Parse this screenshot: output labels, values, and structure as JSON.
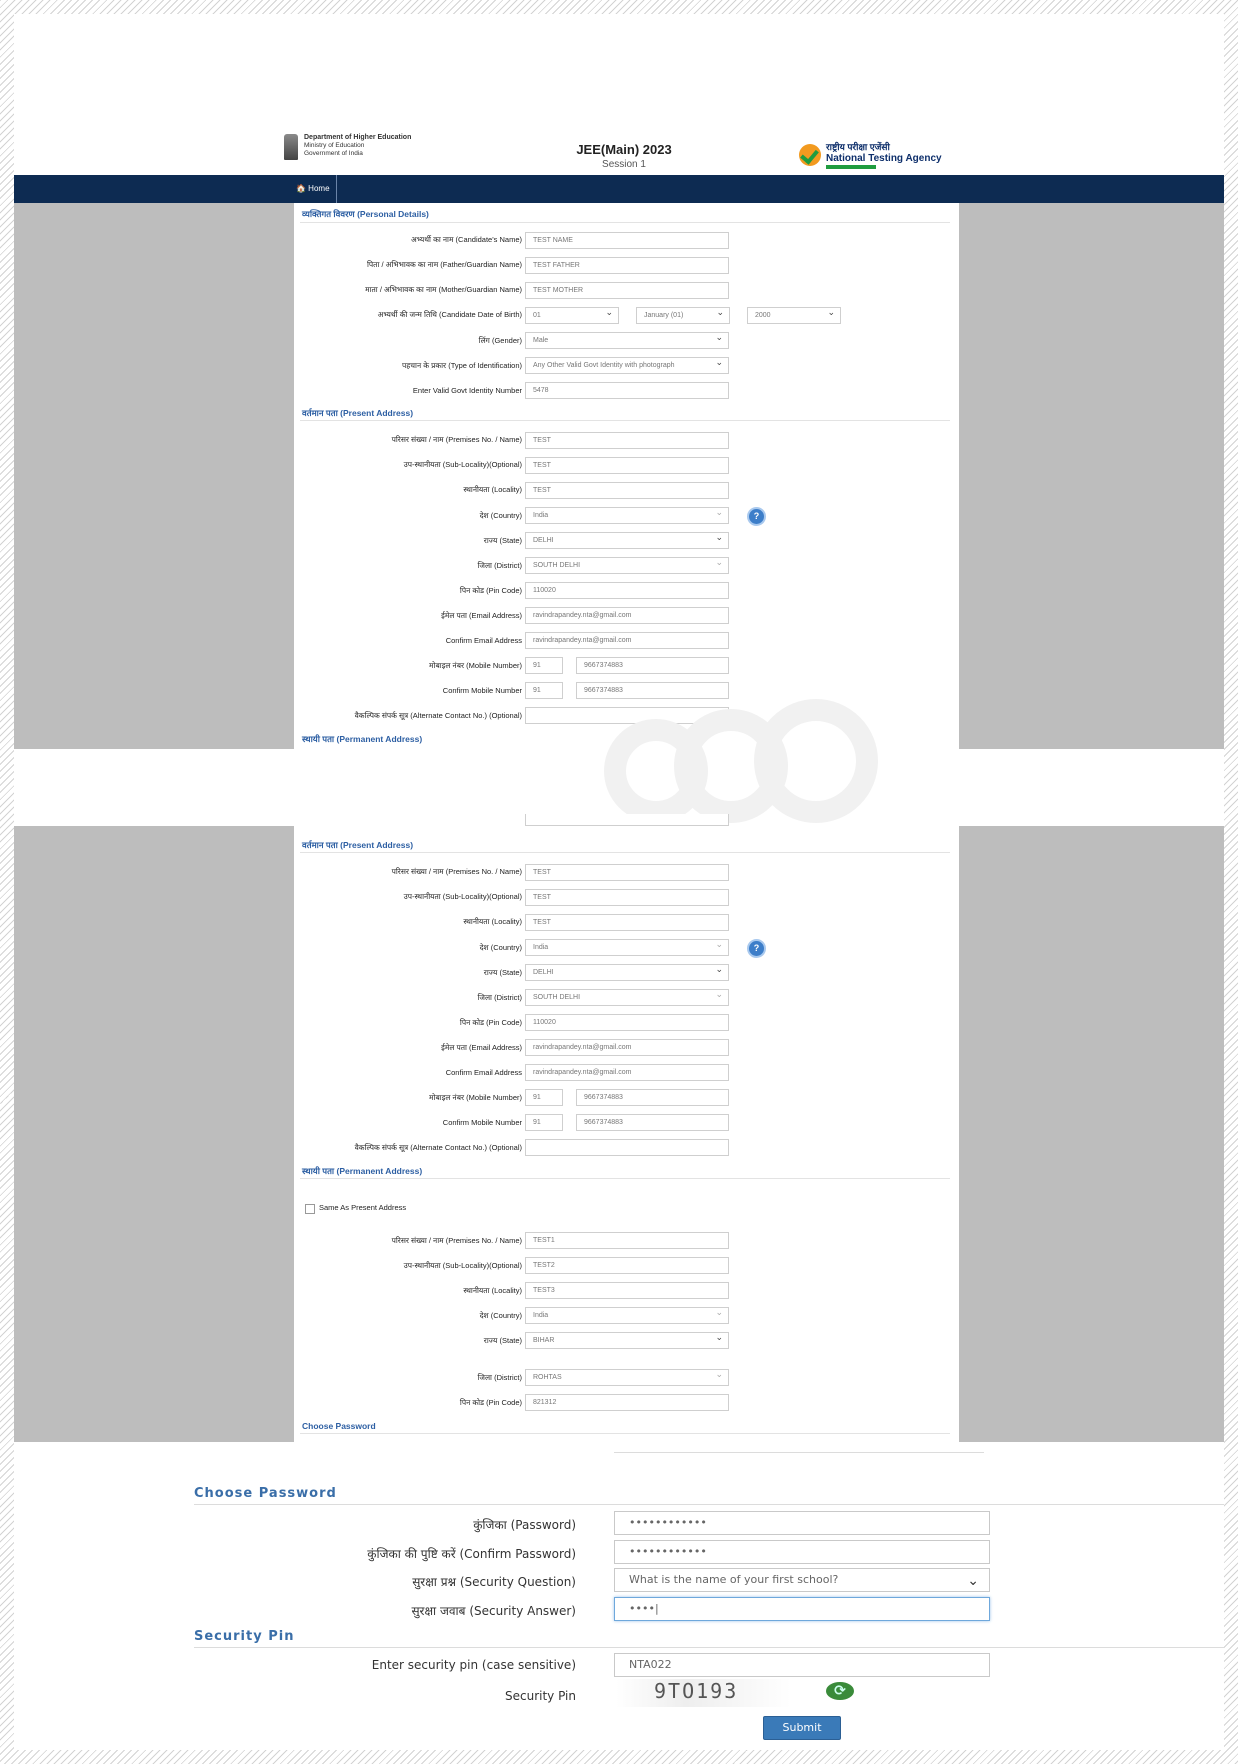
{
  "header": {
    "dept_line1": "Department of Higher Education",
    "dept_line2": "Ministry of Education",
    "dept_line3": "Government of India",
    "exam_title": "JEE(Main) 2023",
    "exam_session": "Session 1",
    "nta_hindi": "राष्ट्रीय परीक्षा एजेंसी",
    "nta_english": "National Testing Agency"
  },
  "nav": {
    "home": "🏠 Home"
  },
  "shot1": {
    "personal_title": "व्यक्तिगत विवरण (Personal Details)",
    "personal": [
      {
        "label": "अभ्यर्थी का नाम (Candidate's Name)",
        "value": "TEST NAME"
      },
      {
        "label": "पिता / अभिभावक का नाम (Father/Guardian Name)",
        "value": "TEST FATHER"
      },
      {
        "label": "माता / अभिभावक का नाम (Mother/Guardian Name)",
        "value": "TEST MOTHER"
      }
    ],
    "dob_label": "अभ्यर्थी की जन्म तिथि (Candidate Date of Birth)",
    "dob_day": "01",
    "dob_month": "January (01)",
    "dob_year": "2000",
    "gender_label": "लिंग (Gender)",
    "gender_value": "Male",
    "id_type_label": "पहचान के प्रकार (Type of Identification)",
    "id_type_value": "Any Other Valid Govt Identity with photograph",
    "id_number_label": "Enter Valid Govt Identity Number",
    "id_number_value": "5478",
    "present_title": "वर्तमान पता (Present Address)",
    "present": [
      {
        "label": "परिसर संख्या / नाम (Premises No. / Name)",
        "value": "TEST"
      },
      {
        "label": "उप-स्थानीयता (Sub-Locality)(Optional)",
        "value": "TEST"
      },
      {
        "label": "स्थानीयता (Locality)",
        "value": "TEST"
      },
      {
        "label": "देश (Country)",
        "value": "India"
      },
      {
        "label": "राज्य (State)",
        "value": "DELHI"
      },
      {
        "label": "जिला (District)",
        "value": "SOUTH DELHI"
      },
      {
        "label": "पिन कोड (Pin Code)",
        "value": "110020"
      },
      {
        "label": "ईमेल पता (Email Address)",
        "value": "ravindrapandey.nta@gmail.com"
      },
      {
        "label": "Confirm Email Address",
        "value": "ravindrapandey.nta@gmail.com"
      }
    ],
    "mobile_label": "मोबाइल नंबर (Mobile Number)",
    "confirm_mobile_label": "Confirm Mobile Number",
    "mobile_code": "91",
    "mobile_value": "9667374883",
    "alt_contact_label": "वैकल्पिक संपर्क सूत्र (Alternate Contact No.) (Optional)",
    "permanent_title": "स्थायी पता (Permanent Address)",
    "help_icon": "?"
  },
  "shot2": {
    "present_title": "वर्तमान पता (Present Address)",
    "permanent_title": "स्थायी पता (Permanent Address)",
    "same_as_present": "Same As Present Address",
    "permanent": [
      {
        "label": "परिसर संख्या / नाम (Premises No. / Name)",
        "value": "TEST1"
      },
      {
        "label": "उप-स्थानीयता (Sub-Locality)(Optional)",
        "value": "TEST2"
      },
      {
        "label": "स्थानीयता (Locality)",
        "value": "TEST3"
      },
      {
        "label": "देश (Country)",
        "value": "India"
      },
      {
        "label": "राज्य (State)",
        "value": "BIHAR"
      },
      {
        "label": "जिला (District)",
        "value": "ROHTAS"
      },
      {
        "label": "पिन कोड (Pin Code)",
        "value": "821312"
      }
    ],
    "choose_password_title": "Choose Password"
  },
  "shot3": {
    "choose_password_title": "Choose Password",
    "password_label": "कुंजिका (Password)",
    "password_value": "••••••••••••",
    "confirm_password_label": "कुंजिका की पुष्टि करें (Confirm Password)",
    "confirm_password_value": "••••••••••••",
    "security_question_label": "सुरक्षा प्रश्न (Security Question)",
    "security_question_value": "What is the name of your first school?",
    "security_answer_label": "सुरक्षा जवाब (Security Answer)",
    "security_answer_value": "••••|",
    "security_pin_title": "Security Pin",
    "enter_pin_label": "Enter security pin (case sensitive)",
    "enter_pin_value": "NTA022",
    "security_pin_label": "Security Pin",
    "captcha_text": "9TO193",
    "refresh_icon": "⟳",
    "submit": "Submit"
  }
}
